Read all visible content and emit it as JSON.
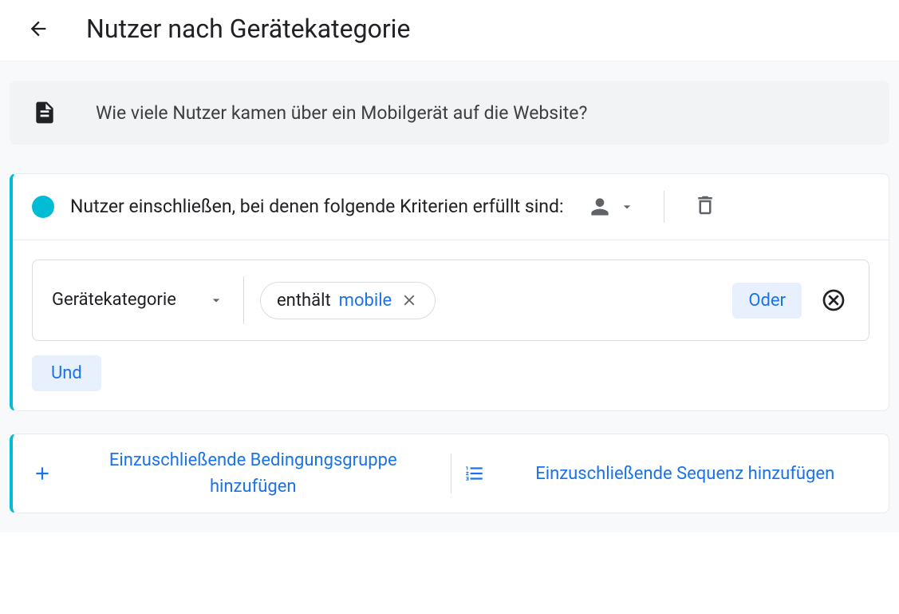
{
  "header": {
    "title": "Nutzer nach Gerätekategorie"
  },
  "description": "Wie viele Nutzer kamen über ein Mobilgerät auf die Website?",
  "condition": {
    "title": "Nutzer einschließen, bei denen folgende Kriterien erfüllt sind:",
    "dimension": "Gerätekategorie",
    "filter": {
      "operator": "enthält",
      "value": "mobile"
    },
    "or_label": "Oder",
    "and_label": "Und"
  },
  "actions": {
    "add_condition_group": "Einzuschließende Bedingungsgruppe hinzufügen",
    "add_sequence": "Einzuschließende Sequenz hinzufügen"
  }
}
